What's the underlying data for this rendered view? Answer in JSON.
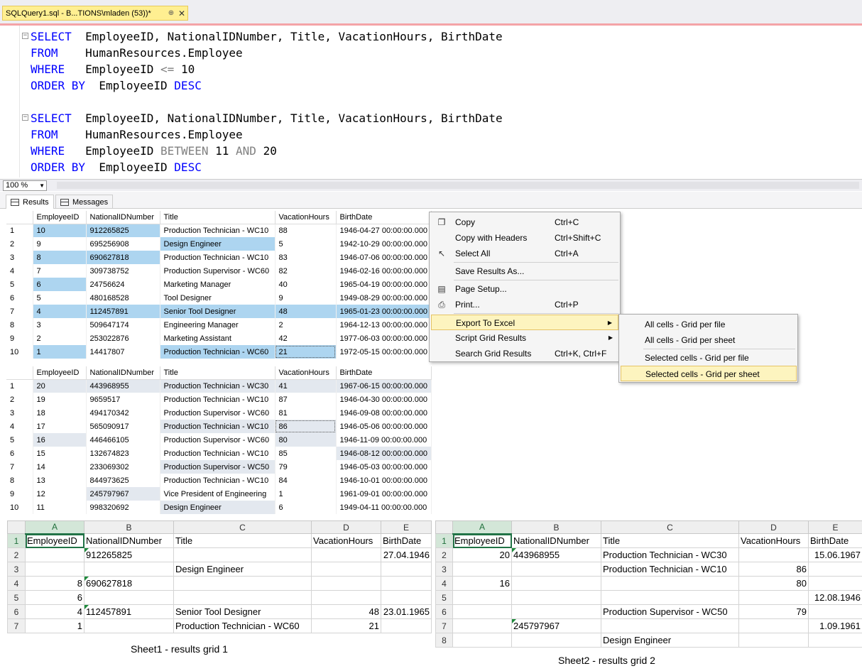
{
  "tab": {
    "title": "SQLQuery1.sql - B...TIONS\\mladen (53))*",
    "pin": "⊕",
    "close": "✕"
  },
  "editor": {
    "q1": {
      "select_kw": "SELECT",
      "select_cols": "EmployeeID, NationalIDNumber, Title, VacationHours, BirthDate",
      "from_kw": "FROM",
      "from_tbl": "HumanResources.Employee",
      "where_kw": "WHERE",
      "where_col": "EmployeeID",
      "where_op": "<=",
      "where_val": "10",
      "order_kw": "ORDER BY",
      "order_col": "EmployeeID",
      "order_dir": "DESC"
    },
    "q2": {
      "select_kw": "SELECT",
      "select_cols": "EmployeeID, NationalIDNumber, Title, VacationHours, BirthDate",
      "from_kw": "FROM",
      "from_tbl": "HumanResources.Employee",
      "where_kw": "WHERE",
      "where_col": "EmployeeID",
      "between_kw": "BETWEEN",
      "v1": "11",
      "and_kw": "AND",
      "v2": "20",
      "order_kw": "ORDER BY",
      "order_col": "EmployeeID",
      "order_dir": "DESC"
    }
  },
  "zoom": "100 %",
  "result_tabs": {
    "results": "Results",
    "messages": "Messages"
  },
  "grid1": {
    "headers": [
      "EmployeeID",
      "NationalIDNumber",
      "Title",
      "VacationHours",
      "BirthDate"
    ],
    "rows": [
      [
        "1",
        "10",
        "912265825",
        "Production Technician - WC10",
        "88",
        "1946-04-27 00:00:00.000"
      ],
      [
        "2",
        "9",
        "695256908",
        "Design Engineer",
        "5",
        "1942-10-29 00:00:00.000"
      ],
      [
        "3",
        "8",
        "690627818",
        "Production Technician - WC10",
        "83",
        "1946-07-06 00:00:00.000"
      ],
      [
        "4",
        "7",
        "309738752",
        "Production Supervisor - WC60",
        "82",
        "1946-02-16 00:00:00.000"
      ],
      [
        "5",
        "6",
        "24756624",
        "Marketing Manager",
        "40",
        "1965-04-19 00:00:00.000"
      ],
      [
        "6",
        "5",
        "480168528",
        "Tool Designer",
        "9",
        "1949-08-29 00:00:00.000"
      ],
      [
        "7",
        "4",
        "112457891",
        "Senior Tool Designer",
        "48",
        "1965-01-23 00:00:00.000"
      ],
      [
        "8",
        "3",
        "509647174",
        "Engineering Manager",
        "2",
        "1964-12-13 00:00:00.000"
      ],
      [
        "9",
        "2",
        "253022876",
        "Marketing Assistant",
        "42",
        "1977-06-03 00:00:00.000"
      ],
      [
        "10",
        "1",
        "14417807",
        "Production Technician - WC60",
        "21",
        "1972-05-15 00:00:00.000"
      ]
    ]
  },
  "grid2": {
    "headers": [
      "EmployeeID",
      "NationalIDNumber",
      "Title",
      "VacationHours",
      "BirthDate"
    ],
    "rows": [
      [
        "1",
        "20",
        "443968955",
        "Production Technician - WC30",
        "41",
        "1967-06-15 00:00:00.000"
      ],
      [
        "2",
        "19",
        "9659517",
        "Production Technician - WC10",
        "87",
        "1946-04-30 00:00:00.000"
      ],
      [
        "3",
        "18",
        "494170342",
        "Production Supervisor - WC60",
        "81",
        "1946-09-08 00:00:00.000"
      ],
      [
        "4",
        "17",
        "565090917",
        "Production Technician - WC10",
        "86",
        "1946-05-06 00:00:00.000"
      ],
      [
        "5",
        "16",
        "446466105",
        "Production Supervisor - WC60",
        "80",
        "1946-11-09 00:00:00.000"
      ],
      [
        "6",
        "15",
        "132674823",
        "Production Technician - WC10",
        "85",
        "1946-08-12 00:00:00.000"
      ],
      [
        "7",
        "14",
        "233069302",
        "Production Supervisor - WC50",
        "79",
        "1946-05-03 00:00:00.000"
      ],
      [
        "8",
        "13",
        "844973625",
        "Production Technician - WC10",
        "84",
        "1946-10-01 00:00:00.000"
      ],
      [
        "9",
        "12",
        "245797967",
        "Vice President of Engineering",
        "1",
        "1961-09-01 00:00:00.000"
      ],
      [
        "10",
        "11",
        "998320692",
        "Design Engineer",
        "6",
        "1949-04-11 00:00:00.000"
      ]
    ]
  },
  "context_menu": {
    "items": [
      {
        "label": "Copy",
        "shortcut": "Ctrl+C"
      },
      {
        "label": "Copy with Headers",
        "shortcut": "Ctrl+Shift+C"
      },
      {
        "label": "Select All",
        "shortcut": "Ctrl+A"
      },
      {
        "label": "Save Results As...",
        "shortcut": ""
      },
      {
        "label": "Page Setup...",
        "shortcut": ""
      },
      {
        "label": "Print...",
        "shortcut": "Ctrl+P"
      },
      {
        "label": "Export To Excel",
        "shortcut": ""
      },
      {
        "label": "Script Grid Results",
        "shortcut": ""
      },
      {
        "label": "Search Grid Results",
        "shortcut": "Ctrl+K, Ctrl+F"
      }
    ]
  },
  "submenu": {
    "items": [
      {
        "label": "All cells - Grid per file"
      },
      {
        "label": "All cells - Grid per sheet"
      },
      {
        "label": "Selected cells - Grid per file"
      },
      {
        "label": "Selected cells - Grid per sheet"
      }
    ]
  },
  "sheet1": {
    "cols": [
      "A",
      "B",
      "C",
      "D",
      "E"
    ],
    "rows": [
      [
        "1",
        "EmployeeID",
        "NationalIDNumber",
        "Title",
        "VacationHours",
        "BirthDate"
      ],
      [
        "2",
        "",
        "912265825",
        "",
        "",
        "27.04.1946"
      ],
      [
        "3",
        "",
        "",
        "Design Engineer",
        "",
        ""
      ],
      [
        "4",
        "8",
        "690627818",
        "",
        "",
        ""
      ],
      [
        "5",
        "6",
        "",
        "",
        "",
        ""
      ],
      [
        "6",
        "4",
        "112457891",
        "Senior Tool Designer",
        "48",
        "23.01.1965"
      ],
      [
        "7",
        "1",
        "",
        "Production Technician - WC60",
        "21",
        ""
      ]
    ],
    "caption": "Sheet1 - results grid 1"
  },
  "sheet2": {
    "cols": [
      "A",
      "B",
      "C",
      "D",
      "E"
    ],
    "rows": [
      [
        "1",
        "EmployeeID",
        "NationalIDNumber",
        "Title",
        "VacationHours",
        "BirthDate"
      ],
      [
        "2",
        "20",
        "443968955",
        "Production Technician - WC30",
        "",
        "15.06.1967"
      ],
      [
        "3",
        "",
        "",
        "Production Technician - WC10",
        "86",
        ""
      ],
      [
        "4",
        "16",
        "",
        "",
        "80",
        ""
      ],
      [
        "5",
        "",
        "",
        "",
        "",
        "12.08.1946"
      ],
      [
        "6",
        "",
        "",
        "Production Supervisor - WC50",
        "79",
        ""
      ],
      [
        "7",
        "",
        "245797967",
        "",
        "",
        "1.09.1961"
      ],
      [
        "8",
        "",
        "",
        "Design Engineer",
        "",
        ""
      ]
    ],
    "caption": "Sheet2 - results grid 2"
  }
}
